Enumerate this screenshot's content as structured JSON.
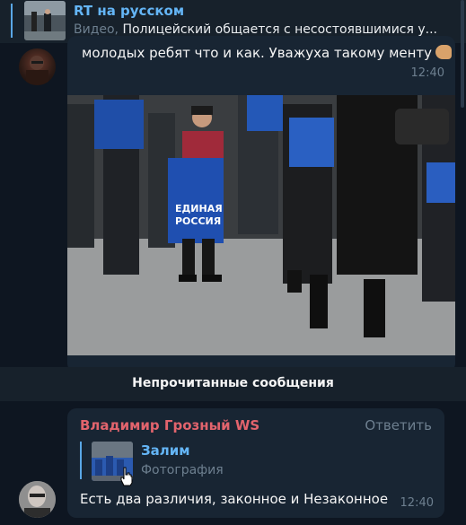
{
  "top_reply": {
    "title": "RT на русском",
    "kind": "Видео,",
    "text": "Полицейский общается с несостоявшимися у..."
  },
  "message1": {
    "text": "молодых ребят что и как. Уважуха такому менту",
    "emoji": "flexed-biceps-emoji",
    "time": "12:40",
    "photo_sign": "ЕДИНАЯ РОССИЯ"
  },
  "unread_divider": "Непрочитанные сообщения",
  "message2": {
    "sender": "Владимир Грозный WS",
    "reply_button": "Ответить",
    "quote_name": "Залим",
    "quote_kind": "Фотография",
    "text": "Есть два различия, законное и Незаконное",
    "time": "12:40"
  },
  "colors": {
    "background": "#0e1621",
    "bubble": "#182533",
    "accent": "#64b5f6",
    "sender": "#e2646d",
    "muted": "#6d7f8f"
  }
}
